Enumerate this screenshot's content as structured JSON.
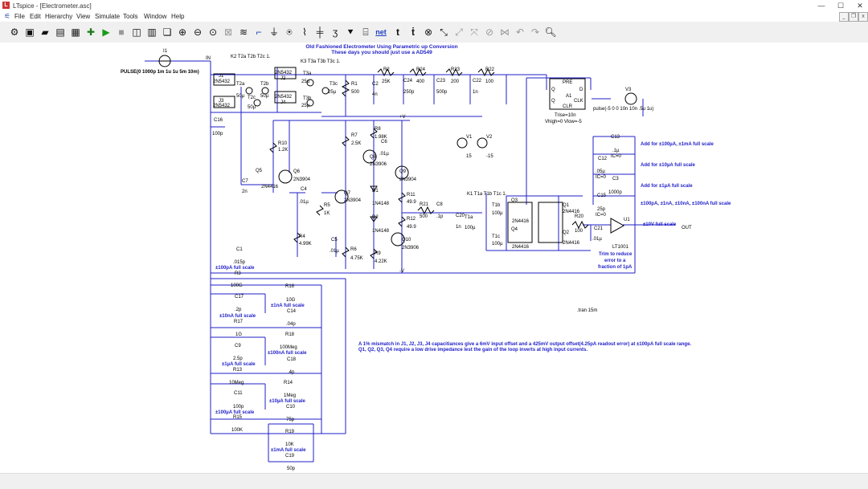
{
  "window": {
    "title": "LTspice - [Electrometer.asc]",
    "minimize": "—",
    "maximize": "☐",
    "close": "✕"
  },
  "menu": [
    {
      "label": "File"
    },
    {
      "label": "Edit"
    },
    {
      "label": "Hierarchy"
    },
    {
      "label": "View"
    },
    {
      "label": "Simulate"
    },
    {
      "label": "Tools"
    },
    {
      "label": "Window"
    },
    {
      "label": "Help"
    }
  ],
  "toolbar": {
    "icons": [
      "gear-icon",
      "open-icon",
      "open-folder-icon",
      "save-icon",
      "print-icon",
      "control-panel-icon",
      "run-icon",
      "halt-icon",
      "tile-horizontal-icon",
      "tile-vertical-icon",
      "cascade-icon",
      "zoom-in-icon",
      "zoom-out-icon",
      "zoom-area-icon",
      "zoom-fit-icon",
      "autorange-icon",
      "wire-icon",
      "ground-icon",
      "label-icon",
      "resistor-icon",
      "capacitor-icon",
      "inductor-icon",
      "diode-icon",
      "component-icon",
      "net-icon",
      "text-icon",
      "spice-directive-icon",
      "delete-icon",
      "move-icon",
      "drag-icon",
      "paste-icon",
      "mirror-icon",
      "rotate-icon",
      "undo-icon",
      "redo-icon",
      "find-icon"
    ],
    "net_label": "net"
  },
  "schematic": {
    "title": "Old Fashioned Electrometer Using Parametric up Conversion",
    "subtitle": "These days you should just use a AD549",
    "labels": {
      "I1": "I1",
      "I1v": "PULSE(0 1000p 1m 1u 1u 5m 10m)",
      "IN": "IN",
      "K2": "K2 T2a T2b T2c 1.",
      "K3": "K3 T3a T3b T3c 1.",
      "K1": "K1 T1a T1b T1c 1.",
      "J1": "J1",
      "J1v": "2N5432",
      "J2": "J2",
      "J2v": "2N5432",
      "J3": "J3",
      "J3v": "2N5432",
      "J4": "J4",
      "J4v": "2N5432",
      "T2a": "T2a",
      "T2av": "50µ",
      "T2b": "T2b",
      "T2bv": "50µ",
      "T2c": "T2c",
      "T2cv": "50µ",
      "T3a": "T3a",
      "T3av": "25µ",
      "T3b": "T3b",
      "T3bv": "25µ",
      "T3c": "T3c",
      "T3cv": "25µ",
      "R1": "R1",
      "R1v": "500",
      "C2": "C2",
      "C2v": "4n",
      "R2": "R2",
      "R2v": "25K",
      "C24": "C24",
      "C24v": "250p",
      "R24": "R24",
      "R24v": "400",
      "C23": "C23",
      "C23v": "500p",
      "R23": "R23",
      "R23v": "200",
      "C22": "C22",
      "C22v": "1n",
      "R22": "R22",
      "R22v": "100",
      "A1": "A1",
      "PRE": "PRE",
      "D": "D",
      "Q": "Q",
      "Qb": "Q",
      "CLK": "CLK",
      "CLR": "CLR",
      "A1p1": "Trise=10n",
      "A1p2": "Vhigh=0 Vlow=-5",
      "V3": "V3",
      "V3v": "pulse(-5 0 0 10n 10n .5u 1u)",
      "C16": "C16",
      "C16v": "100p",
      "R10": "R10",
      "R10v": "1.2K",
      "R7": "R7",
      "R7v": "2.5K",
      "R8": "R8",
      "R8v": "1.98K",
      "C6": "C6",
      "C6v": ".01µ",
      "Q8": "Q8",
      "Q8v": "2N3906",
      "Q9": "Q9",
      "Q9v": "2N3904",
      "Q5": "Q5",
      "Q5v": "2N4416",
      "Q6": "Q6",
      "Q6v": "2N3904",
      "C7": "C7",
      "C7v": "2n",
      "C4": "C4",
      "C4v": ".01µ",
      "Q7": "Q7",
      "Q7v": "2N3904",
      "R5": "R5",
      "R5v": "1K",
      "D1": "D1",
      "D1v": "1N4148",
      "D2": "D2",
      "D2v": "1N4148",
      "R11": "R11",
      "R11v": "49.9",
      "R12": "R12",
      "R12v": "49.9",
      "R21": "R21",
      "R21v": "500",
      "C8": "C8",
      "C8v": ".1p",
      "C20": "C20",
      "C20v": "1n",
      "T1a": "T1a",
      "T1av": "100µ",
      "T1b": "T1b",
      "T1bv": "100µ",
      "T1c": "T1c",
      "T1cv": "100µ",
      "V1": "V1",
      "V1v": "15",
      "V2": "V2",
      "V2v": "-15",
      "R4": "R4",
      "R4v": "4.99K",
      "C5": "C5",
      "C5v": ".01µ",
      "R6": "R6",
      "R6v": "4.75K",
      "R9": "R9",
      "R9v": "4.22K",
      "Q10": "Q10",
      "Q10v": "2N3906",
      "Vp": "+V",
      "Vm": "-V",
      "Q1": "Q1",
      "Q1v": "2N4416",
      "Q2": "Q2",
      "Q2v": "2N4416",
      "Q3": "Q3",
      "Q3v": "2N4416",
      "Q4": "Q4",
      "Q4v": "2N4416",
      "R20": "R20",
      "R20v": "100",
      "C21": "C21",
      "C21v": ".01µ",
      "U1": "U1",
      "U1v": "LT1001",
      "C13": "C13",
      "C13v": ".1µ",
      "C13ic": "IC=0",
      "C12": "C12",
      "C12v": ".05µ",
      "C12ic": "IC=0",
      "C3": "C3",
      "C3v": "1000p",
      "C15": "C15",
      "C15v": "25p",
      "C15ic": "IC=0",
      "add1": "Add for ±100µA, ±1mA full scale",
      "add2": "Add for ±10µA full scale",
      "add3": "Add for ±1µA full scale",
      "add4": "±100pA, ±1nA, ±10nA, ±100nA full scale",
      "fs10": "±10V full scale",
      "OUT": "OUT",
      "trim1": "Trim to reduce",
      "trim2": "error to a",
      "trim3": "fraction of 1pA",
      "C1": "C1",
      "C1v": ".015p",
      "C1fs": "±100pA full scale",
      "R3": "R3",
      "R3v": "100G",
      "R16": "R16",
      "R16v": "10G",
      "R16fs": "±1nA full scale",
      "C14": "C14",
      "C14v": ".04p",
      "C17": "C17",
      "C17v": ".2p",
      "C17fs": "±10nA full scale",
      "R17": "R17",
      "R17v": "1G",
      "R18": "R18",
      "R18v": "100Meg",
      "R18fs": "±100nA full scale",
      "C18": "C18",
      "C18v": ".4p",
      "C9": "C9",
      "C9v": "2.5p",
      "C9fs": "±1µA full scale",
      "R13": "R13",
      "R13v": "10Meg",
      "R14": "R14",
      "R14v": "1Meg",
      "R14fs": "±10µA full scale",
      "C10": "C10",
      "C10v": "75p",
      "C11": "C11",
      "C11v": "100p",
      "C11fs": "±100µA full scale",
      "R15": "R15",
      "R15v": "100K",
      "R19": "R19",
      "R19v": "10K",
      "R19fs": "±1mA full scale",
      "C19": "C19",
      "C19v": "50p",
      "tran": ".tran 15m",
      "note1": "A 1% mismatch in J1, J2, J3, J4 capacitiances give a 6mV input offset and a 425mV output offset(4.25pA readout error) at ±100pA full scale range.",
      "note2": "Q1, Q2, Q3, Q4 require a low drive impedance lest the gain of the loop inverts at high input currents."
    }
  }
}
